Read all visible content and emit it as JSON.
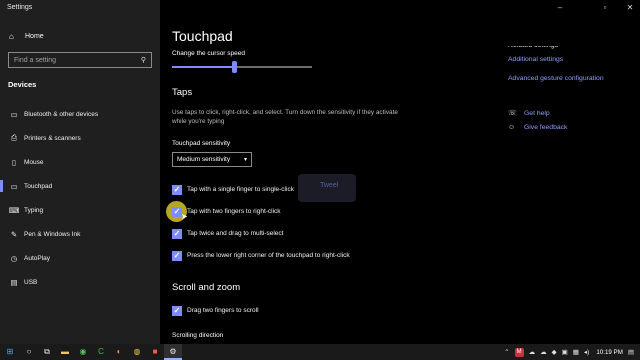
{
  "window": {
    "title": "Settings"
  },
  "sidebar": {
    "home_label": "Home",
    "search_placeholder": "Find a setting",
    "section_title": "Devices",
    "items": [
      {
        "label": "Bluetooth & other devices",
        "icon": "bluetooth-icon"
      },
      {
        "label": "Printers & scanners",
        "icon": "printer-icon"
      },
      {
        "label": "Mouse",
        "icon": "mouse-icon"
      },
      {
        "label": "Touchpad",
        "icon": "touchpad-icon",
        "active": true
      },
      {
        "label": "Typing",
        "icon": "keyboard-icon"
      },
      {
        "label": "Pen & Windows Ink",
        "icon": "pen-icon"
      },
      {
        "label": "AutoPlay",
        "icon": "autoplay-icon"
      },
      {
        "label": "USB",
        "icon": "usb-icon"
      }
    ]
  },
  "main": {
    "page_title": "Touchpad",
    "cursor_speed_label": "Change the cursor speed",
    "cursor_speed_value": 0.44,
    "taps": {
      "title": "Taps",
      "description": "Use taps to click, right-click, and select. Turn down the sensitivity if they activate while you're typing",
      "sensitivity_label": "Touchpad sensitivity",
      "sensitivity_value": "Medium sensitivity",
      "options": [
        {
          "label": "Tap with a single finger to single-click",
          "checked": true
        },
        {
          "label": "Tap with two fingers to right-click",
          "checked": true
        },
        {
          "label": "Tap twice and drag to multi-select",
          "checked": true
        },
        {
          "label": "Press the lower right corner of the touchpad to right-click",
          "checked": true
        }
      ]
    },
    "scroll_zoom": {
      "title": "Scroll and zoom",
      "options": [
        {
          "label": "Drag two fingers to scroll",
          "checked": true
        }
      ],
      "scrolling_direction_label": "Scrolling direction"
    },
    "watermark_text": "Tweel"
  },
  "related": {
    "heading": "Related settings",
    "links": [
      "Additional settings",
      "Advanced gesture configuration"
    ],
    "help": {
      "label": "Get help",
      "icon": "help-chat-icon"
    },
    "feedback": {
      "label": "Give feedback",
      "icon": "feedback-icon"
    }
  },
  "taskbar": {
    "time": "10:19 PM",
    "apps": [
      "start-icon",
      "search-icon",
      "task-view-icon",
      "file-explorer-icon",
      "xbox-icon",
      "camtasia-icon",
      "firefox-icon",
      "chrome-icon",
      "office-icon",
      "settings-icon"
    ]
  },
  "colors": {
    "accent": "#7d8cff",
    "link": "#8da0ff",
    "sidebar_bg": "#1f1f1f",
    "highlight": "#d7c328"
  }
}
